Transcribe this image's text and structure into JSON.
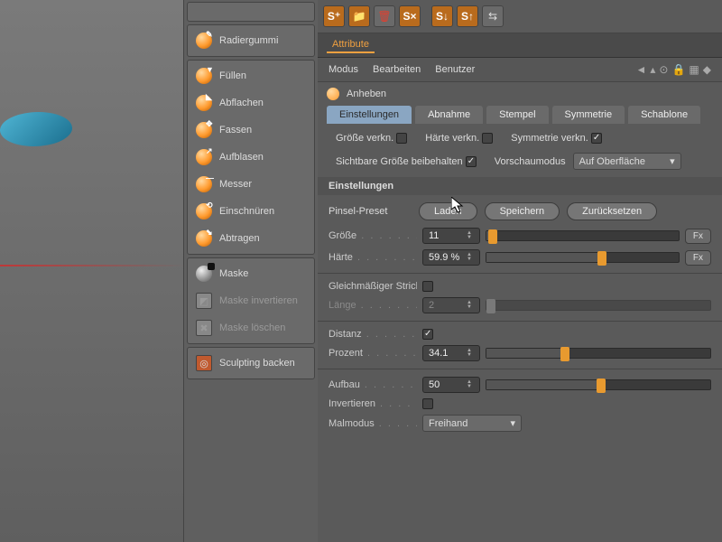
{
  "tools": {
    "group_a": [
      {
        "name": "radiergummi",
        "label": "Radiergummi"
      }
    ],
    "group_b": [
      {
        "name": "fuellen",
        "label": "Füllen"
      },
      {
        "name": "abflachen",
        "label": "Abflachen"
      },
      {
        "name": "fassen",
        "label": "Fassen"
      },
      {
        "name": "aufblasen",
        "label": "Aufblasen"
      },
      {
        "name": "messer",
        "label": "Messer"
      },
      {
        "name": "einschnueren",
        "label": "Einschnüren"
      },
      {
        "name": "abtragen",
        "label": "Abtragen"
      }
    ],
    "group_c": [
      {
        "name": "maske",
        "label": "Maske"
      },
      {
        "name": "maske-invertieren",
        "label": "Maske invertieren"
      },
      {
        "name": "maske-loeschen",
        "label": "Maske löschen"
      }
    ],
    "group_d": [
      {
        "name": "sculpting-backen",
        "label": "Sculpting backen"
      }
    ]
  },
  "attr": {
    "tab": "Attribute",
    "menus": [
      "Modus",
      "Bearbeiten",
      "Benutzer"
    ],
    "tool_name": "Anheben",
    "tabs": [
      "Einstellungen",
      "Abnahme",
      "Stempel",
      "Symmetrie",
      "Schablone"
    ],
    "check1": {
      "groesse": "Größe verkn.",
      "haerte": "Härte verkn.",
      "sym": "Symmetrie verkn."
    },
    "check2": {
      "sichtbar": "Sichtbare Größe beibehalten",
      "vorschau": "Vorschaumodus",
      "vorschau_val": "Auf Oberfläche"
    },
    "section": "Einstellungen",
    "preset": {
      "label": "Pinsel-Preset",
      "laden": "Laden",
      "speichern": "Speichern",
      "zurueck": "Zurücksetzen"
    },
    "size": {
      "label": "Größe",
      "value": "11",
      "fx": "Fx"
    },
    "hard": {
      "label": "Härte",
      "value": "59.9 %",
      "fx": "Fx"
    },
    "even": {
      "label": "Gleichmäßiger Strich"
    },
    "len": {
      "label": "Länge",
      "value": "2"
    },
    "dist": {
      "label": "Distanz"
    },
    "percent": {
      "label": "Prozent",
      "value": "34.1"
    },
    "aufbau": {
      "label": "Aufbau",
      "value": "50"
    },
    "invert": {
      "label": "Invertieren"
    },
    "paintmode": {
      "label": "Malmodus",
      "value": "Freihand"
    }
  }
}
